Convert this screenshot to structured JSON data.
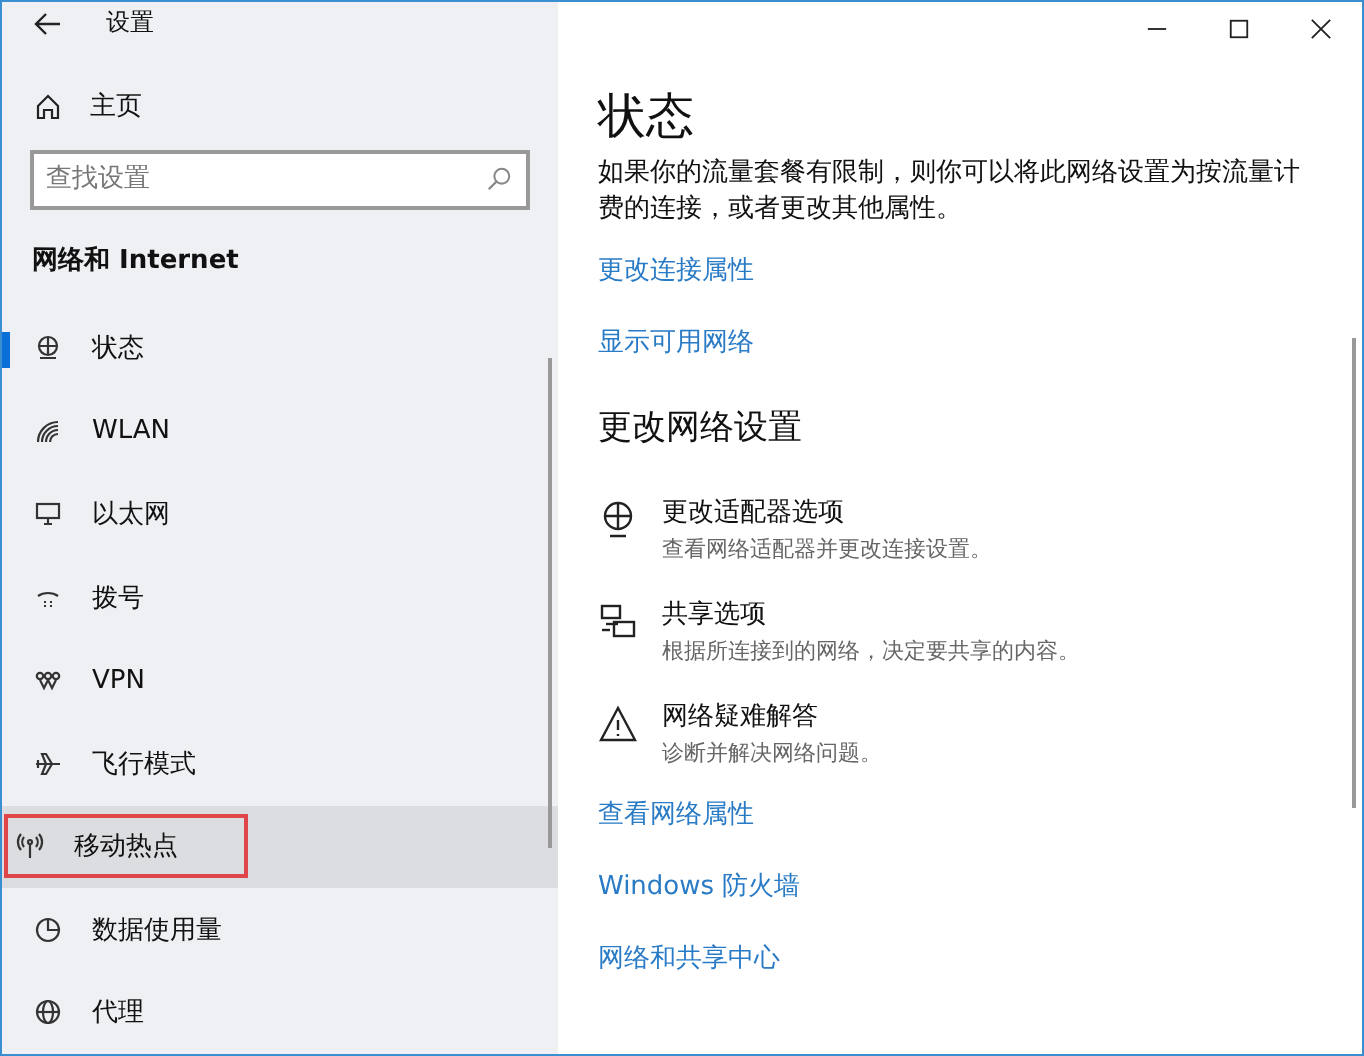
{
  "window": {
    "title": "设置"
  },
  "sidebar": {
    "home": "主页",
    "search": {
      "placeholder": "查找设置"
    },
    "section": "网络和 Internet",
    "items": [
      {
        "label": "状态",
        "selected": true,
        "highlighted": false
      },
      {
        "label": "WLAN",
        "selected": false,
        "highlighted": false
      },
      {
        "label": "以太网",
        "selected": false,
        "highlighted": false
      },
      {
        "label": "拨号",
        "selected": false,
        "highlighted": false
      },
      {
        "label": "VPN",
        "selected": false,
        "highlighted": false
      },
      {
        "label": "飞行模式",
        "selected": false,
        "highlighted": false
      },
      {
        "label": "移动热点",
        "selected": false,
        "highlighted": true
      },
      {
        "label": "数据使用量",
        "selected": false,
        "highlighted": false
      },
      {
        "label": "代理",
        "selected": false,
        "highlighted": false
      }
    ]
  },
  "content": {
    "title": "状态",
    "paragraph": "如果你的流量套餐有限制，则你可以将此网络设置为按流量计费的连接，或者更改其他属性。",
    "links_top": [
      "更改连接属性",
      "显示可用网络"
    ],
    "section": "更改网络设置",
    "options": [
      {
        "title": "更改适配器选项",
        "description": "查看网络适配器并更改连接设置。"
      },
      {
        "title": "共享选项",
        "description": "根据所连接到的网络，决定要共享的内容。"
      },
      {
        "title": "网络疑难解答",
        "description": "诊断并解决网络问题。"
      }
    ],
    "links_bottom": [
      "查看网络属性",
      "Windows 防火墙",
      "网络和共享中心"
    ]
  }
}
